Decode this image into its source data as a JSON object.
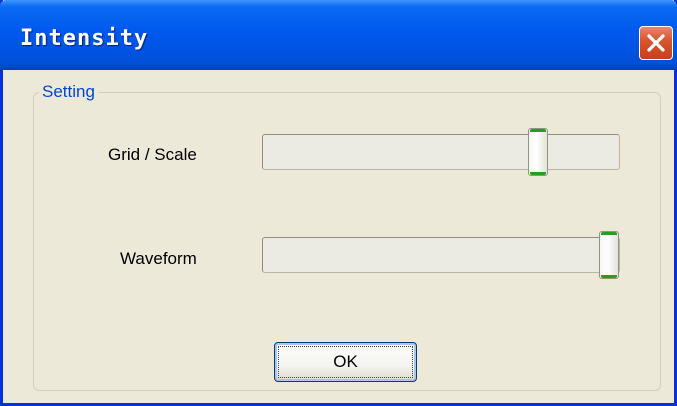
{
  "window": {
    "title": "Intensity",
    "close_icon": "close-icon"
  },
  "group": {
    "legend": "Setting"
  },
  "sliders": [
    {
      "label": "Grid / Scale",
      "value_fraction": 0.8
    },
    {
      "label": "Waveform",
      "value_fraction": 1.0
    }
  ],
  "buttons": {
    "ok_label": "OK"
  },
  "colors": {
    "titlebar": "#0054e3",
    "close_button": "#d9562f",
    "legend_text": "#0046d5",
    "slider_accent": "#21a121",
    "dialog_background": "#ece9d8"
  }
}
